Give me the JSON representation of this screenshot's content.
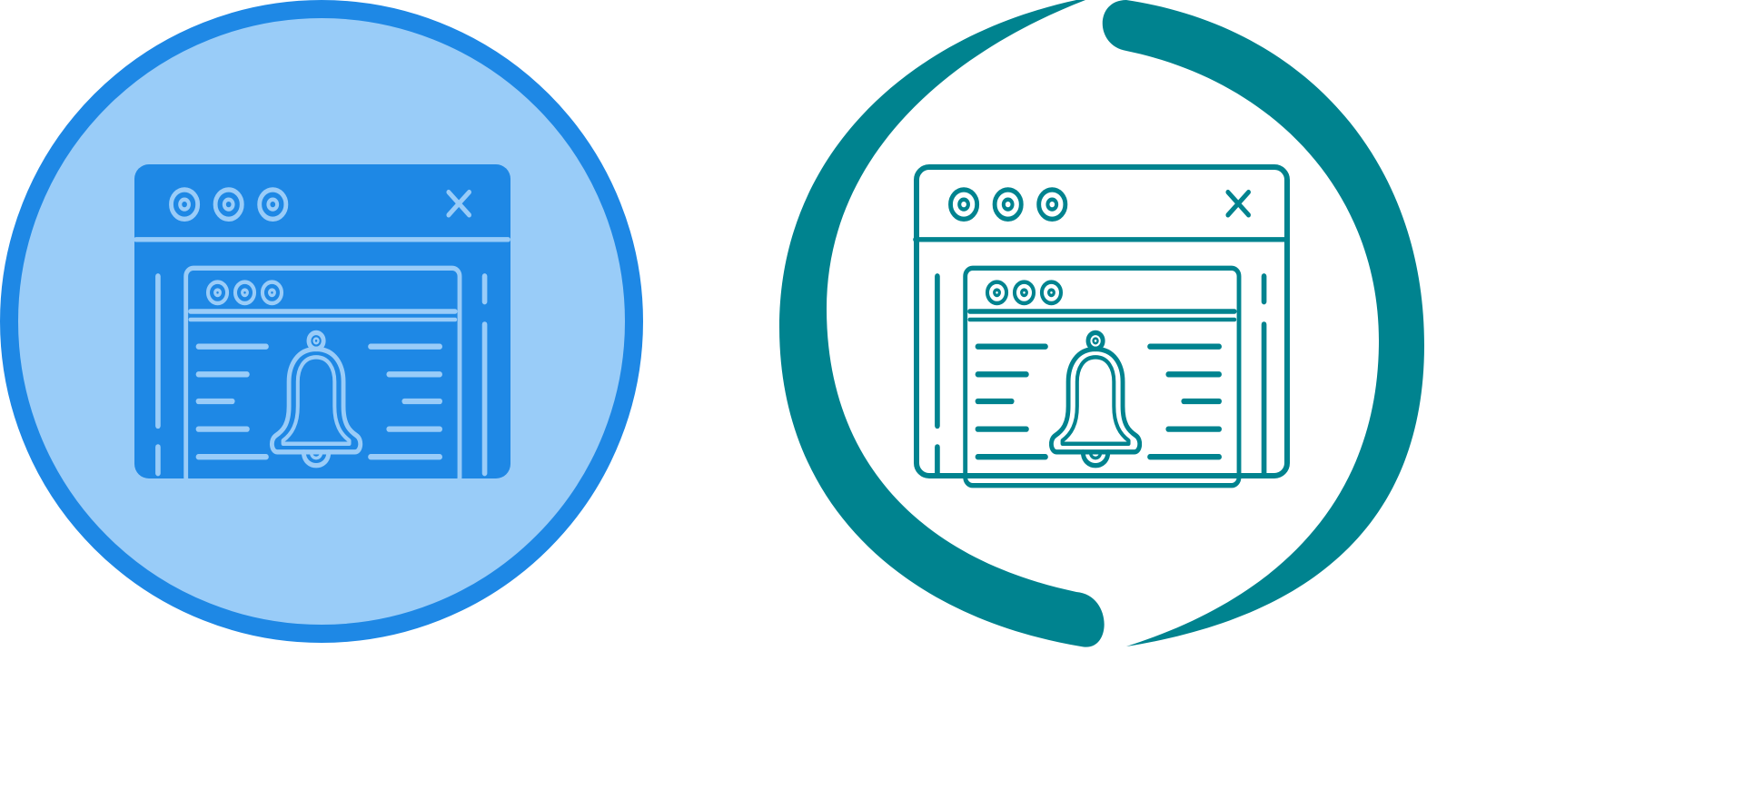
{
  "icons": [
    {
      "name": "web-notification-icon",
      "style": "filled-circle",
      "colors": {
        "circle_fill": "#99CCF8",
        "circle_ring": "#1E88E5",
        "window_fill": "#1E88E5",
        "line": "#99CCF8"
      }
    },
    {
      "name": "web-notification-icon",
      "style": "outline-with-arcs",
      "colors": {
        "arc": "#00838F",
        "line": "#00838F",
        "background": "#FFFFFF"
      }
    }
  ]
}
